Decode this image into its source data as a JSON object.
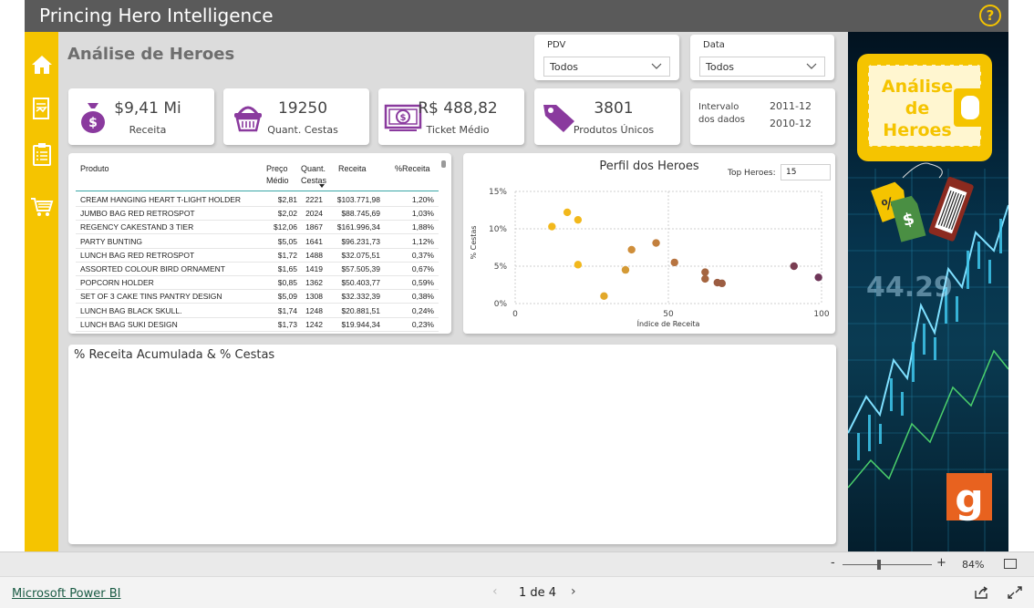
{
  "app": {
    "title": "Princing Hero Intelligence"
  },
  "page": {
    "title": "Análise de Heroes"
  },
  "slicers": [
    {
      "label": "PDV",
      "value": "Todos"
    },
    {
      "label": "Data",
      "value": "Todos"
    }
  ],
  "kpis": [
    {
      "value": "$9,41 Mi",
      "caption": "Receita",
      "icon": "money-bag-icon"
    },
    {
      "value": "19250",
      "caption": "Quant. Cestas",
      "icon": "basket-icon"
    },
    {
      "value": "R$ 488,82",
      "caption": "Ticket Médio",
      "icon": "banknote-icon"
    },
    {
      "value": "3801",
      "caption": "Produtos Únicos",
      "icon": "price-tag-icon"
    }
  ],
  "interval": {
    "label_line1": "Intervalo",
    "label_line2": "dos dados",
    "date1": "2011-12",
    "date2": "2010-12"
  },
  "table": {
    "headers": {
      "product": "Produto",
      "price_1": "Preço",
      "price_2": "Médio",
      "cestas_1": "Quant.",
      "cestas_2": "Cestas",
      "receita": "Receita",
      "pct": "%Receita"
    },
    "rows": [
      {
        "product": "CREAM HANGING HEART T-LIGHT HOLDER",
        "price": "$2,81",
        "cestas": "2221",
        "receita": "$103.771,98",
        "pct": "1,20%"
      },
      {
        "product": "JUMBO BAG RED RETROSPOT",
        "price": "$2,02",
        "cestas": "2024",
        "receita": "$88.745,69",
        "pct": "1,03%"
      },
      {
        "product": "REGENCY CAKESTAND 3 TIER",
        "price": "$12,06",
        "cestas": "1867",
        "receita": "$161.996,34",
        "pct": "1,88%"
      },
      {
        "product": "PARTY BUNTING",
        "price": "$5,05",
        "cestas": "1641",
        "receita": "$96.231,73",
        "pct": "1,12%"
      },
      {
        "product": "LUNCH BAG RED RETROSPOT",
        "price": "$1,72",
        "cestas": "1488",
        "receita": "$32.075,51",
        "pct": "0,37%"
      },
      {
        "product": "ASSORTED COLOUR BIRD ORNAMENT",
        "price": "$1,65",
        "cestas": "1419",
        "receita": "$57.505,39",
        "pct": "0,67%"
      },
      {
        "product": "POPCORN HOLDER",
        "price": "$0,85",
        "cestas": "1362",
        "receita": "$50.403,77",
        "pct": "0,59%"
      },
      {
        "product": "SET OF 3 CAKE TINS PANTRY DESIGN",
        "price": "$5,09",
        "cestas": "1308",
        "receita": "$32.332,39",
        "pct": "0,38%"
      },
      {
        "product": "LUNCH BAG BLACK SKULL.",
        "price": "$1,74",
        "cestas": "1248",
        "receita": "$20.881,51",
        "pct": "0,24%"
      },
      {
        "product": "LUNCH BAG SUKI DESIGN",
        "price": "$1,73",
        "cestas": "1242",
        "receita": "$19.944,34",
        "pct": "0,23%"
      }
    ]
  },
  "scatter": {
    "top_heroes_label": "Top Heroes:",
    "top_heroes_value": "15"
  },
  "chart_data": {
    "type": "scatter",
    "title": "Perfil dos Heroes",
    "xlabel": "Índice de Receita",
    "ylabel": "% Cestas",
    "xlim": [
      0,
      100
    ],
    "ylim": [
      0,
      15
    ],
    "x_ticks": [
      "0",
      "50",
      "100"
    ],
    "y_ticks": [
      "0%",
      "5%",
      "10%",
      "15%"
    ],
    "grid": true,
    "points": [
      {
        "x": 12,
        "y": 10.3,
        "color": "#f2b81c"
      },
      {
        "x": 17,
        "y": 12.2,
        "color": "#f2b81c"
      },
      {
        "x": 20.5,
        "y": 11.2,
        "color": "#f2b81c"
      },
      {
        "x": 20.5,
        "y": 5.2,
        "color": "#f2b81c"
      },
      {
        "x": 29,
        "y": 1.0,
        "color": "#e2a82a"
      },
      {
        "x": 36,
        "y": 4.5,
        "color": "#d49a35"
      },
      {
        "x": 38,
        "y": 7.2,
        "color": "#cf8e3a"
      },
      {
        "x": 46,
        "y": 8.1,
        "color": "#c27f3d"
      },
      {
        "x": 52,
        "y": 5.5,
        "color": "#b77440"
      },
      {
        "x": 62,
        "y": 4.2,
        "color": "#a5653f"
      },
      {
        "x": 62,
        "y": 3.3,
        "color": "#a5653f"
      },
      {
        "x": 66,
        "y": 2.8,
        "color": "#9c5d42"
      },
      {
        "x": 67.5,
        "y": 2.7,
        "color": "#9c5d42"
      },
      {
        "x": 91,
        "y": 5.0,
        "color": "#7a3e52"
      },
      {
        "x": 99,
        "y": 3.5,
        "color": "#6e3558"
      }
    ]
  },
  "combo": {
    "title": "% Receita Acumulada & % Cestas"
  },
  "art": {
    "badge_text": "Análise de Heroes",
    "logo_letter": "g"
  },
  "zoom": {
    "minus": "-",
    "plus": "+",
    "percent": "84%"
  },
  "footer": {
    "brand": "Microsoft Power BI",
    "page_indicator": "1 de 4",
    "prev": "‹",
    "next": "›"
  },
  "colors": {
    "accent": "#f5c400",
    "titlebar": "#5a5a5a",
    "canvas": "#dcdcdc",
    "icon_purple": "#8a3a9e"
  }
}
